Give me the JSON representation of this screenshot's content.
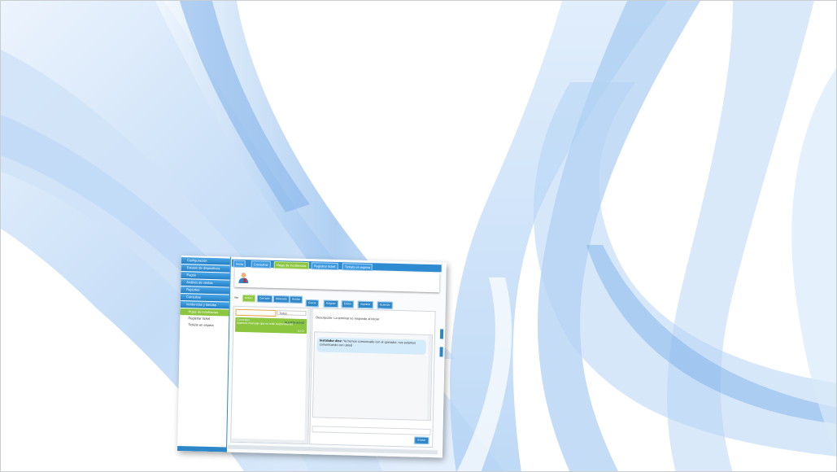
{
  "sidebar": {
    "items": [
      "Configuración",
      "Estatus de dispositivos",
      "Pagos",
      "Análisis de ventas",
      "Reportes",
      "Consultas",
      "Incidencias y tiendas"
    ],
    "subitems": [
      "Hojas de incidencias",
      "Registrar ticket",
      "Tickets en espera"
    ]
  },
  "tabs": [
    "Inicio",
    "Consultas",
    "Hojas de incidencias",
    "Registrar ticket",
    "Tickets en espera"
  ],
  "toolbar": {
    "label": "Ver",
    "filters": [
      "Activo",
      "Cerrado",
      "Atrasado",
      "Anular"
    ],
    "actions": [
      "Cerrar",
      "Asignar",
      "Editar",
      "Imprimir",
      "Guardar"
    ]
  },
  "list": {
    "filter_value": "Todos",
    "item": {
      "tag": "Consultas",
      "status": "ALERTA AVISO",
      "text": "Aparece mensaje que no está respondiendo",
      "time": "10:11"
    }
  },
  "detail": {
    "description": "Descripción: La terminal no responde al iniciar",
    "chat_author": "Instalador dice:",
    "chat_text": "Ya hemos comunicado con el operador, nos estamos comunicando con usted",
    "send_label": "Enviar"
  },
  "colors": {
    "accent": "#2d86c8",
    "active": "#8cc63f",
    "wave": "#4a90e2"
  }
}
